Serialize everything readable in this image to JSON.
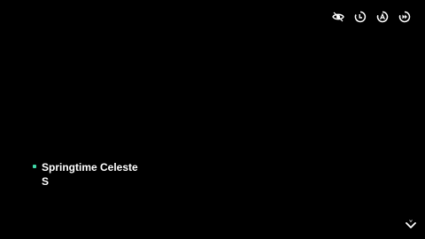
{
  "toolbar": {
    "icons": [
      "eye-icon",
      "history-icon",
      "auto-icon",
      "skip-icon"
    ],
    "icon_color": "#ffffff"
  },
  "choices": [
    {
      "label": "Springtime Celeste S",
      "bullet_color": "#3fd6a6"
    }
  ],
  "advance": {
    "icon": "chevron-down-icon",
    "color": "#ffffff"
  }
}
